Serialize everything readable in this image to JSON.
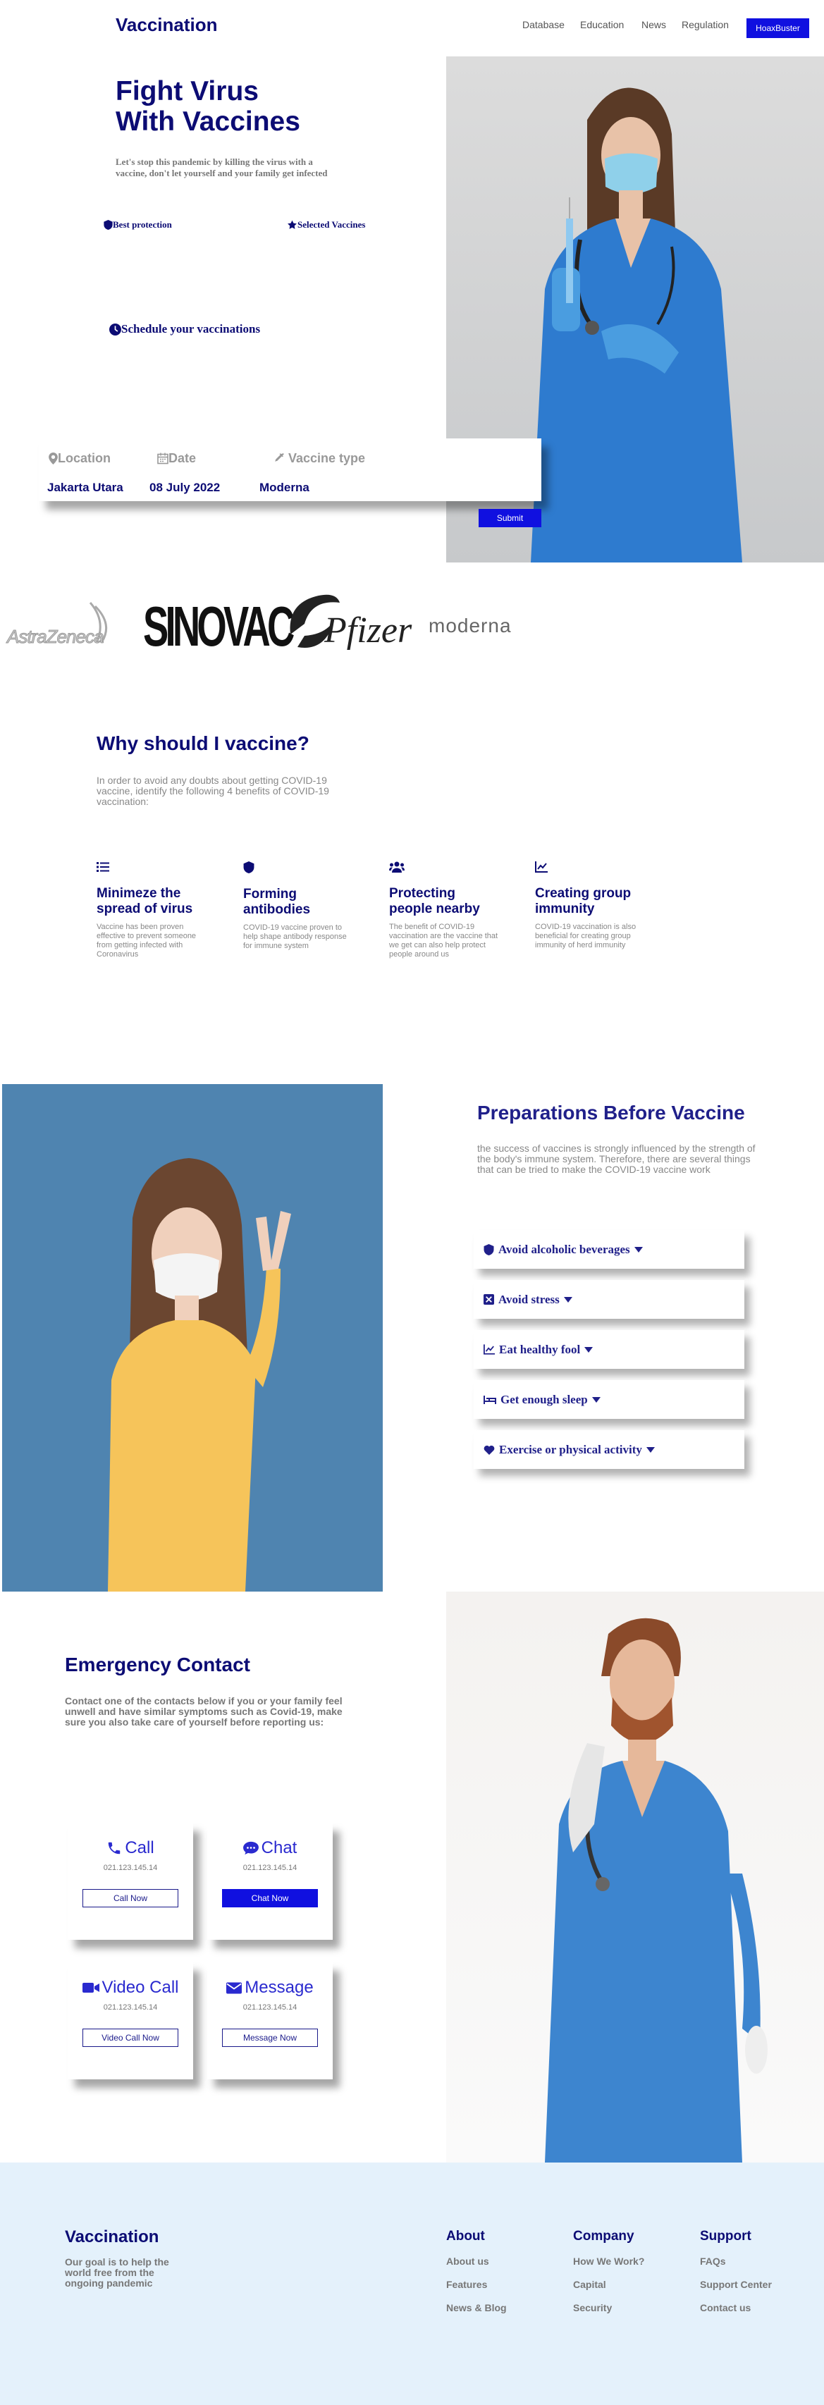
{
  "header": {
    "brand": "Vaccination",
    "nav": [
      "Database",
      "Education",
      "News",
      "Regulation"
    ],
    "cta": "HoaxBuster"
  },
  "hero": {
    "title_line1": "Fight Virus",
    "title_line2": "With Vaccines",
    "description": "Let's stop this pandemic by killing the virus with a vaccine, don't let yourself and your family get infected",
    "feature1": "Best protection",
    "feature2": "Selected Vaccines",
    "schedule": "Schedule your vaccinations"
  },
  "booking": {
    "location_label": "Location",
    "location_value": "Jakarta Utara",
    "date_label": "Date",
    "date_value": "08 July 2022",
    "type_label": "Vaccine type",
    "type_value": "Moderna",
    "submit": "Submit"
  },
  "brands": [
    "AstraZeneca",
    "SINOVAC",
    "Pfizer",
    "moderna"
  ],
  "why": {
    "title": "Why should I vaccine?",
    "description": "In order to avoid any doubts about getting COVID-19 vaccine, identify the following 4 benefits of COVID-19 vaccination:",
    "benefits": [
      {
        "title": "Minimeze the spread of virus",
        "text": "Vaccine has been proven effective to prevent someone from getting infected with Coronavirus"
      },
      {
        "title": "Forming antibodies",
        "text": "COVID-19 vaccine proven to help shape antibody response for immune system"
      },
      {
        "title": "Protecting people nearby",
        "text": "The benefit of COVID-19 vaccination are the vaccine that we get can also help protect people around us"
      },
      {
        "title": "Creating group immunity",
        "text": "COVID-19 vaccination is also beneficial for creating group immunity of herd immunity"
      }
    ]
  },
  "prep": {
    "title": "Preparations Before Vaccine",
    "description": "the success of vaccines is strongly influenced by the strength of the body's immune system. Therefore, there are several things that can be tried to make the COVID-19 vaccine work",
    "items": [
      "Avoid alcoholic beverages",
      "Avoid stress",
      "Eat healthy fool",
      "Get enough sleep",
      "Exercise or physical activity"
    ]
  },
  "emergency": {
    "title": "Emergency Contact",
    "description": "Contact one of the contacts below if you or your family feel unwell and have similar symptoms such as Covid-19, make sure you also take care of yourself before reporting us:",
    "cards": [
      {
        "title": "Call",
        "number": "021.123.145.14",
        "button": "Call Now"
      },
      {
        "title": "Chat",
        "number": "021.123.145.14",
        "button": "Chat Now"
      },
      {
        "title": "Video Call",
        "number": "021.123.145.14",
        "button": "Video Call Now"
      },
      {
        "title": "Message",
        "number": "021.123.145.14",
        "button": "Message Now"
      }
    ]
  },
  "footer": {
    "brand": "Vaccination",
    "tagline": "Our goal is to help the world free from the ongoing pandemic",
    "about": {
      "title": "About",
      "links": [
        "About us",
        "Features",
        "News & Blog"
      ]
    },
    "company": {
      "title": "Company",
      "links": [
        "How We Work?",
        "Capital",
        "Security"
      ]
    },
    "support": {
      "title": "Support",
      "links": [
        "FAQs",
        "Support Center",
        "Contact us"
      ]
    }
  },
  "colors": {
    "navy": "#0c0c74",
    "accent": "#1010e0",
    "footer_bg": "#e4f1fb"
  }
}
